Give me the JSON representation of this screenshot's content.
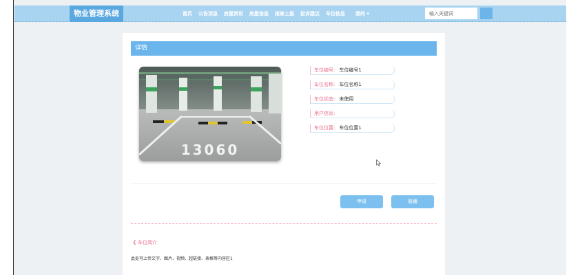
{
  "header": {
    "logo": "物业管理系统",
    "nav": [
      "首页",
      "公告消息",
      "房屋资讯",
      "房屋信息",
      "报修上报",
      "投诉建议",
      "车位信息"
    ],
    "mine": "我的",
    "search_placeholder": "输入关键词"
  },
  "detail": {
    "title": "详情",
    "fields": [
      {
        "label": "车位编号:",
        "value": "车位编号1"
      },
      {
        "label": "车位名称:",
        "value": "车位名称1"
      },
      {
        "label": "车位状态:",
        "value": "未使用"
      },
      {
        "label": "用户信息:",
        "value": ""
      },
      {
        "label": "车位位置:",
        "value": "车位位置1"
      }
    ],
    "photo_text": "13060",
    "apply_label": "申请",
    "favorite_label": "收藏",
    "section_mark": "《",
    "section_title": "车位简介",
    "description": "此处可上传文字、图片、视频、超链接、表格等内容区1"
  },
  "colors": {
    "topbar": "#a9d4f1",
    "accent_blue": "#69b5ec",
    "accent_pink": "#e8708f"
  }
}
